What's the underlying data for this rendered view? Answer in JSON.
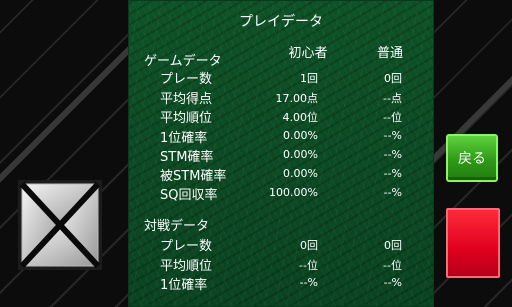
{
  "screen": {
    "title": "プレイデータ"
  },
  "columns": {
    "beginner": "初心者",
    "normal": "普通"
  },
  "game_data": {
    "label": "ゲームデータ",
    "rows": [
      {
        "label": "プレー数",
        "beginner": "1回",
        "normal": "0回"
      },
      {
        "label": "平均得点",
        "beginner": "17.00点",
        "normal": "--点"
      },
      {
        "label": "平均順位",
        "beginner": "4.00位",
        "normal": "--位"
      },
      {
        "label": "1位確率",
        "beginner": "0.00%",
        "normal": "--%"
      },
      {
        "label": "STM確率",
        "beginner": "0.00%",
        "normal": "--%"
      },
      {
        "label": "被STM確率",
        "beginner": "0.00%",
        "normal": "--%"
      },
      {
        "label": "SQ回収率",
        "beginner": "100.00%",
        "normal": "--%"
      }
    ]
  },
  "battle_data": {
    "label": "対戦データ",
    "rows": [
      {
        "label": "プレー数",
        "beginner": "0回",
        "normal": "0回"
      },
      {
        "label": "平均順位",
        "beginner": "--位",
        "normal": "--位"
      },
      {
        "label": "1位確率",
        "beginner": "--%",
        "normal": "--%"
      }
    ]
  },
  "buttons": {
    "back_label": "戻る"
  },
  "colors": {
    "panel": "#0d4a23",
    "back_button": "#2e9a18",
    "red_button": "#e0001e"
  }
}
